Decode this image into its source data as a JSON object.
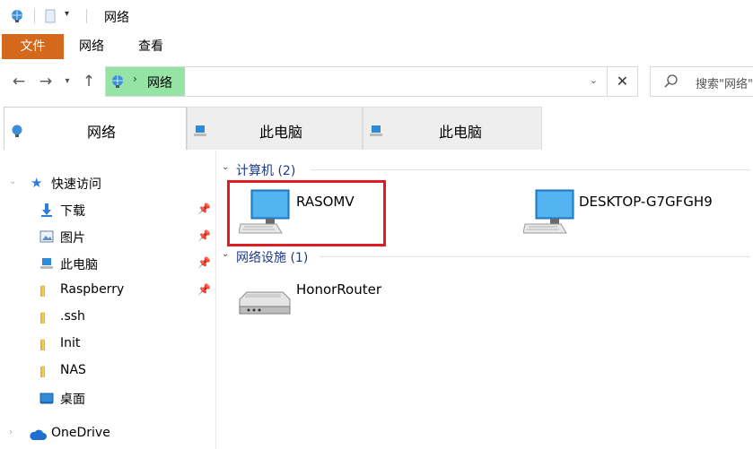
{
  "window": {
    "title": "网络"
  },
  "ribbon": {
    "tabs": [
      "文件",
      "网络",
      "查看"
    ]
  },
  "address": {
    "crumb": "网络",
    "search_placeholder": "搜索\"网络\""
  },
  "location_tabs": [
    "网络",
    "此电脑",
    "此电脑"
  ],
  "sidebar": {
    "quick_access": "快速访问",
    "items": [
      {
        "label": "下载",
        "icon": "download-arrow-icon",
        "pinned": true
      },
      {
        "label": "图片",
        "icon": "pictures-icon",
        "pinned": true
      },
      {
        "label": "此电脑",
        "icon": "computer-icon",
        "pinned": true
      },
      {
        "label": "Raspberry",
        "icon": "folder-icon",
        "pinned": true
      },
      {
        "label": ".ssh",
        "icon": "folder-icon",
        "pinned": false
      },
      {
        "label": "Init",
        "icon": "folder-icon",
        "pinned": false
      },
      {
        "label": "NAS",
        "icon": "folder-icon",
        "pinned": false
      },
      {
        "label": "桌面",
        "icon": "desktop-icon",
        "pinned": false
      }
    ],
    "onedrive": "OneDrive"
  },
  "groups": {
    "computers": {
      "header": "计算机 (2)",
      "items": [
        "RASOMV",
        "DESKTOP-G7GFGH9"
      ]
    },
    "devices": {
      "header": "网络设施 (1)",
      "items": [
        "HonorRouter"
      ]
    }
  },
  "colors": {
    "file_tab": "#d4691e",
    "address_highlight": "#95e3a5",
    "highlight_box": "#e01b24",
    "group_header": "#1e3a8a"
  }
}
